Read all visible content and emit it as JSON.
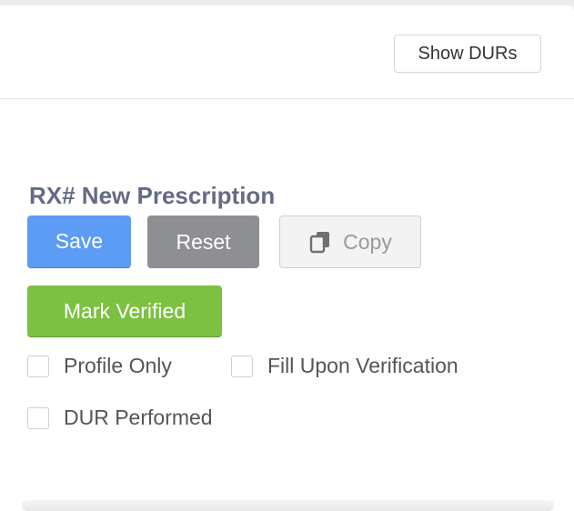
{
  "header": {
    "show_durs_label": "Show DURs"
  },
  "form": {
    "title": "RX# New Prescription",
    "save_label": "Save",
    "reset_label": "Reset",
    "copy_label": "Copy",
    "mark_verified_label": "Mark Verified",
    "checkboxes": [
      {
        "label": "Profile Only",
        "checked": false
      },
      {
        "label": "Fill Upon Verification",
        "checked": false
      },
      {
        "label": "DUR Performed",
        "checked": false
      }
    ]
  },
  "colors": {
    "save": "#5c9cf5",
    "reset": "#8e8f92",
    "mark_verified": "#7cc142",
    "title": "#646b86"
  },
  "icons": {
    "copy": "copy-icon"
  }
}
